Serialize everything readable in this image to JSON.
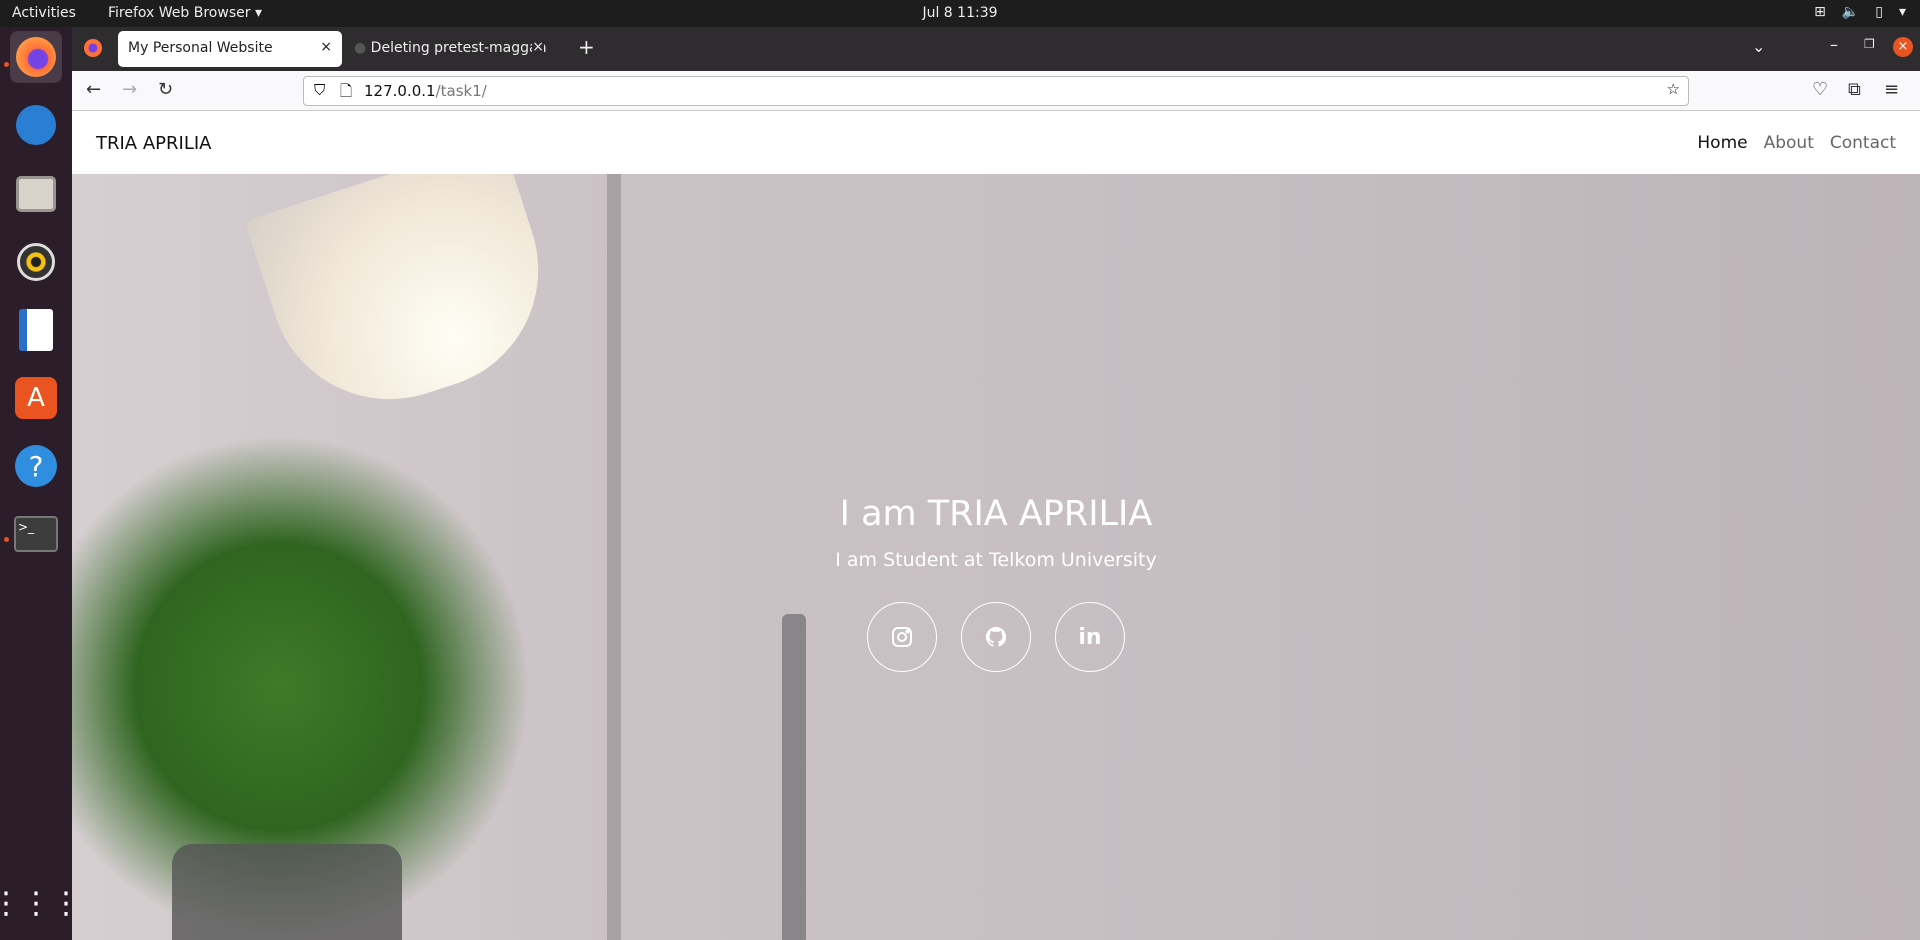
{
  "system": {
    "activities": "Activities",
    "app_menu": "Firefox Web Browser ▾",
    "clock": "Jul 8  11:39"
  },
  "browser": {
    "tabs": [
      {
        "label": "My Personal Website"
      },
      {
        "label": "Deleting pretest-maggan"
      }
    ],
    "url_host": "127.0.0.1",
    "url_path": "/task1/"
  },
  "site": {
    "brand": "TRIA APRILIA",
    "nav": [
      "Home",
      "About",
      "Contact"
    ],
    "hero_title": "I am TRIA APRILIA",
    "hero_subtitle": "I am Student at Telkom University",
    "socials": [
      "instagram-icon",
      "github-icon",
      "linkedin-icon"
    ],
    "linkedin_glyph": "in"
  }
}
